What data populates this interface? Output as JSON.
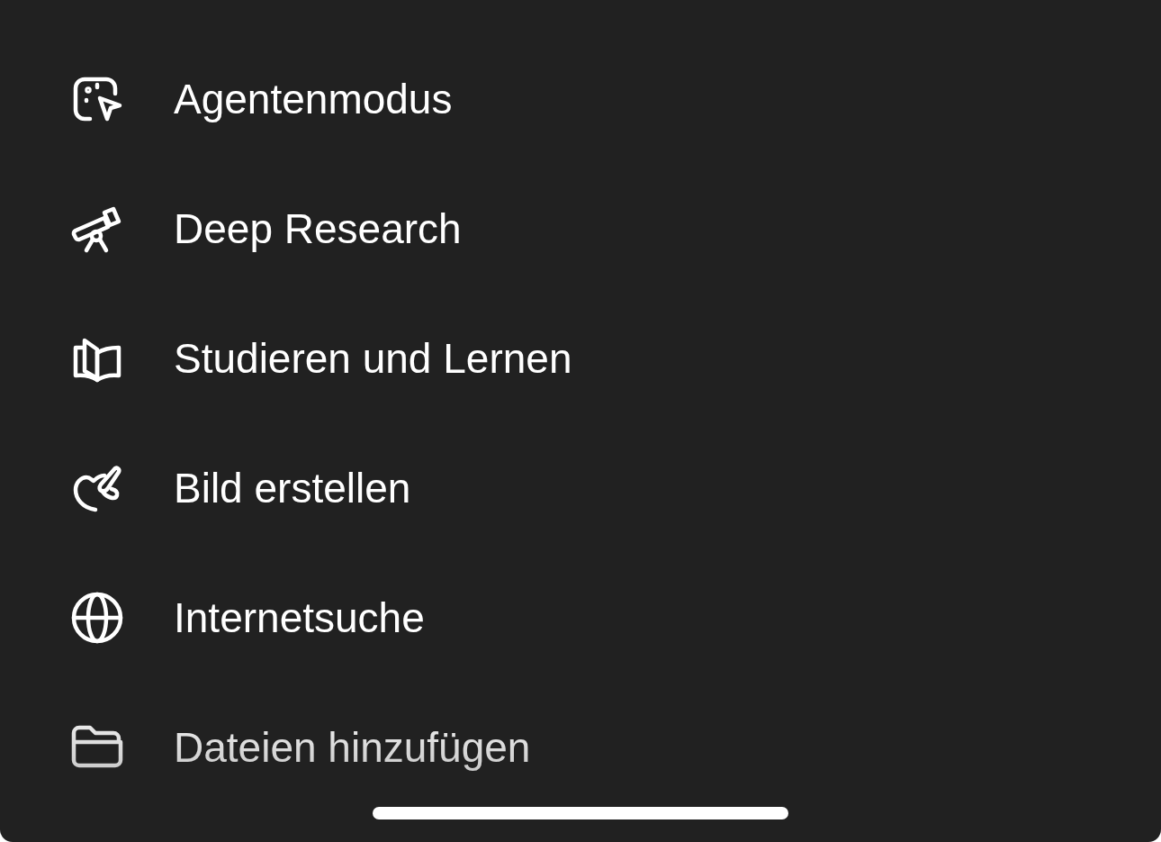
{
  "menu": {
    "items": [
      {
        "kind": "agent",
        "label": "Agentenmodus"
      },
      {
        "kind": "research",
        "label": "Deep Research"
      },
      {
        "kind": "study",
        "label": "Studieren und Lernen"
      },
      {
        "kind": "image",
        "label": "Bild erstellen"
      },
      {
        "kind": "web",
        "label": "Internetsuche"
      },
      {
        "kind": "files",
        "label": "Dateien hinzufügen"
      }
    ]
  }
}
